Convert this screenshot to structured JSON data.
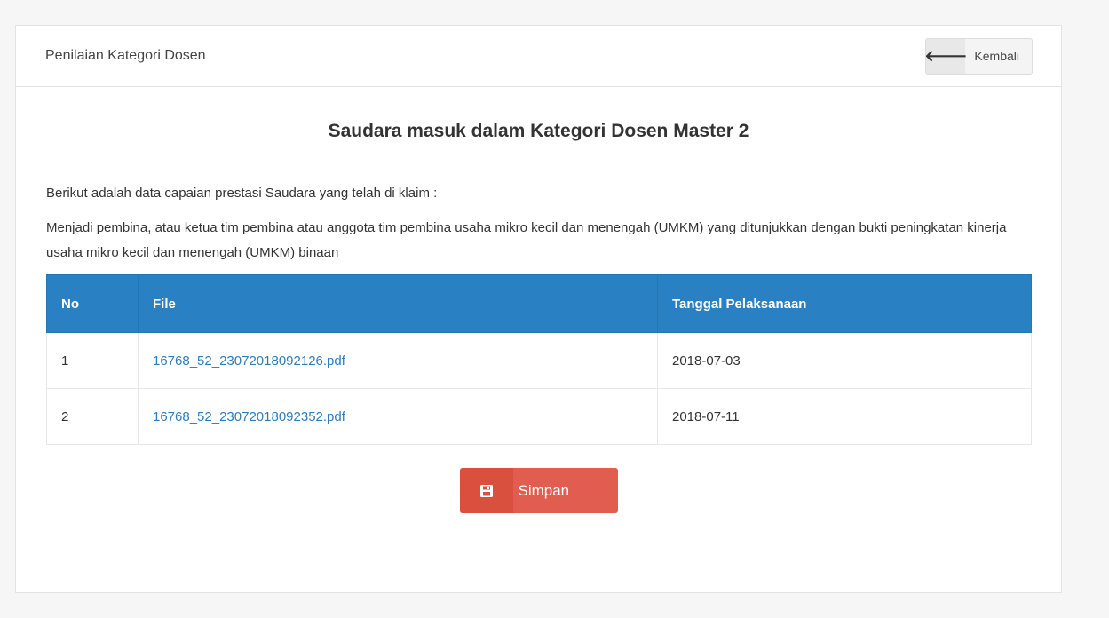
{
  "panel": {
    "title": "Penilaian Kategori Dosen",
    "back_label": "Kembali",
    "back_icon": "arrow-left-icon"
  },
  "content": {
    "heading": "Saudara masuk dalam Kategori Dosen Master 2",
    "intro": "Berikut adalah data capaian prestasi Saudara yang telah di klaim :",
    "description": "Menjadi pembina, atau ketua tim pembina atau anggota tim pembina usaha mikro kecil dan menengah (UMKM) yang ditunjukkan dengan bukti peningkatan kinerja usaha mikro kecil dan menengah (UMKM) binaan"
  },
  "table": {
    "headers": [
      "No",
      "File",
      "Tanggal Pelaksanaan"
    ],
    "rows": [
      {
        "no": "1",
        "file": "16768_52_23072018092126.pdf",
        "date": "2018-07-03"
      },
      {
        "no": "2",
        "file": "16768_52_23072018092352.pdf",
        "date": "2018-07-11"
      }
    ]
  },
  "actions": {
    "save_label": "Simpan",
    "save_icon": "floppy-disk-icon"
  },
  "colors": {
    "table_header": "#2980c2",
    "link": "#2d7cbc",
    "save_button": "#e05d4f"
  }
}
